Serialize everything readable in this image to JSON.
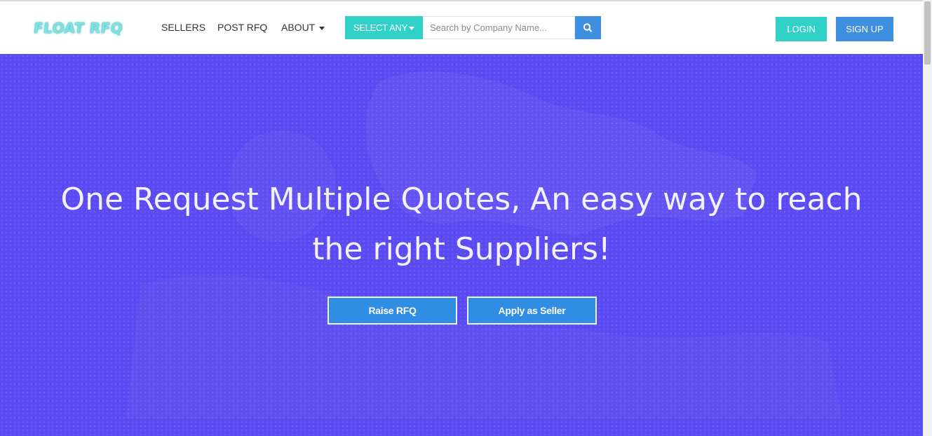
{
  "brand": {
    "logo_text": "FLOAT RFQ"
  },
  "nav": {
    "sellers": "SELLERS",
    "post_rfq": "POST RFQ",
    "about": "ABOUT"
  },
  "search": {
    "select_label": "SELECT ANY",
    "placeholder": "Search by Company Name..."
  },
  "auth": {
    "login": "LOGIN",
    "signup": "SIGN UP"
  },
  "hero": {
    "headline_line1": "One Request Multiple Quotes, An easy way to reach",
    "headline_line2": "the right Suppliers!",
    "raise_rfq": "Raise RFQ",
    "apply_seller": "Apply as Seller"
  },
  "colors": {
    "hero_bg": "#5a4af2",
    "accent_teal": "#2fd1c8",
    "accent_blue": "#3f8fe0"
  }
}
